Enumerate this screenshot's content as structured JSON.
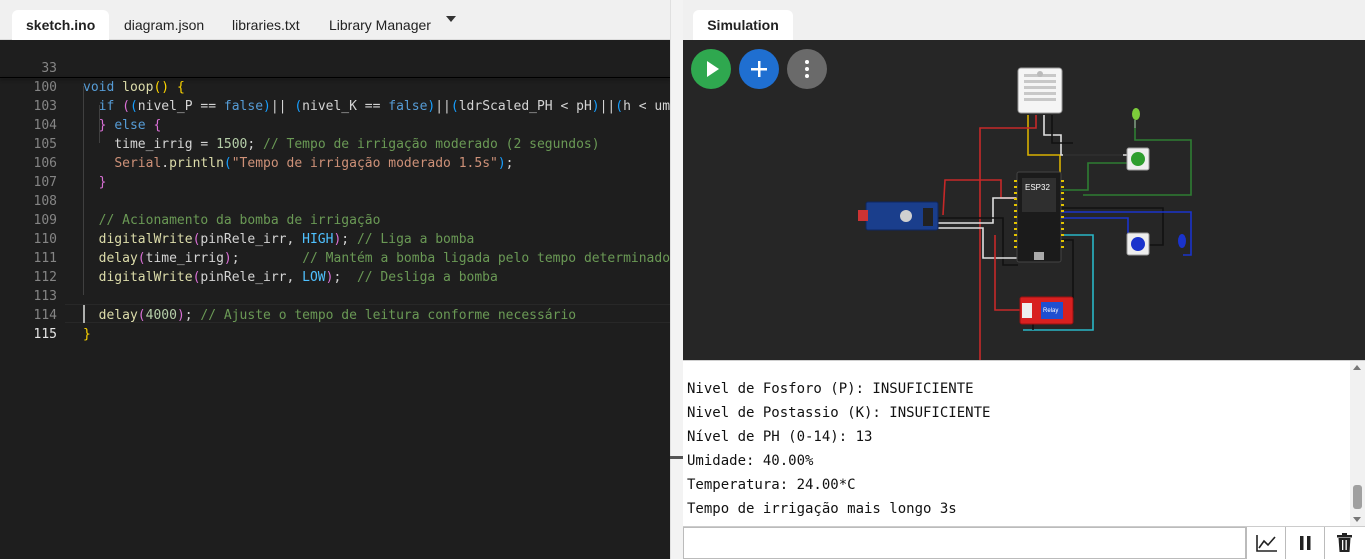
{
  "editor": {
    "tabs": [
      "sketch.ino",
      "diagram.json",
      "libraries.txt",
      "Library Manager"
    ],
    "active_tab": "sketch.ino",
    "sticky_lines": [
      {
        "n": "33",
        "text": "void loop() {"
      },
      {
        "n": "100",
        "text": "  if ((nivel_P == false)|| (nivel_K == false)||(ldrScaled_PH < pH)||(h < umi"
      }
    ],
    "lines": [
      {
        "n": "103",
        "text": "  } else {"
      },
      {
        "n": "104",
        "text": "    time_irrig = 1500; // Tempo de irrigação moderado (2 segundos)"
      },
      {
        "n": "105",
        "text": "    Serial.println(\"Tempo de irrigação moderado 1.5s\");"
      },
      {
        "n": "106",
        "text": "  }"
      },
      {
        "n": "107",
        "text": ""
      },
      {
        "n": "108",
        "text": "  // Acionamento da bomba de irrigação"
      },
      {
        "n": "109",
        "text": "  digitalWrite(pinRele_irr, HIGH); // Liga a bomba"
      },
      {
        "n": "110",
        "text": "  delay(time_irrig);        // Mantém a bomba ligada pelo tempo determinado"
      },
      {
        "n": "111",
        "text": "  digitalWrite(pinRele_irr, LOW);  // Desliga a bomba"
      },
      {
        "n": "112",
        "text": ""
      },
      {
        "n": "113",
        "text": "  delay(4000); // Ajuste o tempo de leitura conforme necessário"
      },
      {
        "n": "114",
        "text": "}"
      },
      {
        "n": "115",
        "text": ""
      }
    ]
  },
  "simulation": {
    "tab": "Simulation",
    "buttons": {
      "play": "play-icon",
      "add": "plus-icon",
      "more": "more-vertical-icon"
    },
    "parts": {
      "mcu_label": "ESP32",
      "relay_label": "Relay"
    }
  },
  "console": {
    "lines": [
      "Nivel de Fosforo (P): INSUFICIENTE",
      "Nivel de Postassio (K): INSUFICIENTE",
      "Nível de PH (0-14): 13",
      "Umidade: 40.00%",
      "Temperatura: 24.00*C",
      "Tempo de irrigação mais longo 3s"
    ],
    "input_value": "",
    "tools": [
      "chart-icon",
      "pause-icon",
      "trash-icon"
    ]
  },
  "colors": {
    "play": "#2fa84f",
    "add": "#1f6fd1",
    "more": "#6a6a6a",
    "editor_bg": "#1e1e1e",
    "canvas_bg": "#262626"
  }
}
